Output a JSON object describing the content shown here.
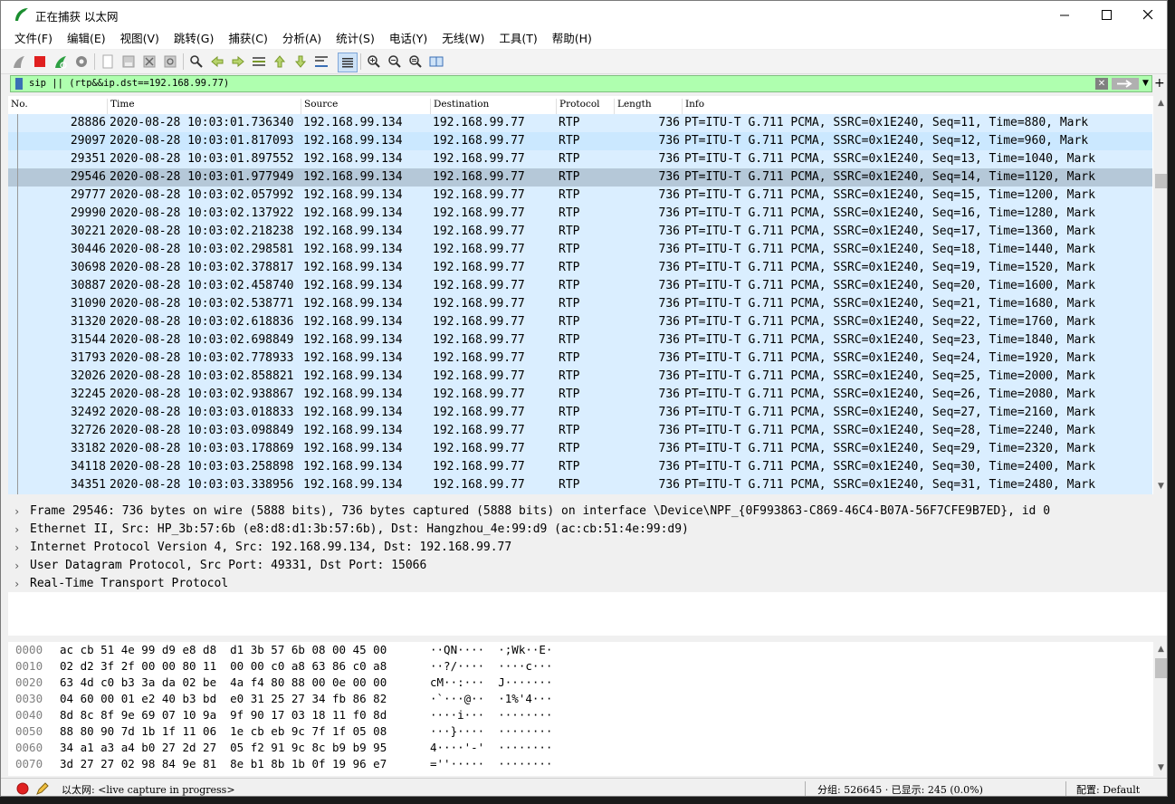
{
  "window": {
    "title": "正在捕获 以太网"
  },
  "menu": [
    "文件(F)",
    "编辑(E)",
    "视图(V)",
    "跳转(G)",
    "捕获(C)",
    "分析(A)",
    "统计(S)",
    "电话(Y)",
    "无线(W)",
    "工具(T)",
    "帮助(H)"
  ],
  "filter": {
    "value": "sip || (rtp&&ip.dst==192.168.99.77)"
  },
  "columns": [
    "No.",
    "Time",
    "Source",
    "Destination",
    "Protocol",
    "Length",
    "Info"
  ],
  "packets": [
    {
      "no": "28886",
      "time": "2020-08-28 10:03:01.736340",
      "src": "192.168.99.134",
      "dst": "192.168.99.77",
      "proto": "RTP",
      "len": "736",
      "info": "PT=ITU-T G.711 PCMA, SSRC=0x1E240, Seq=11, Time=880, Mark"
    },
    {
      "no": "29097",
      "time": "2020-08-28 10:03:01.817093",
      "src": "192.168.99.134",
      "dst": "192.168.99.77",
      "proto": "RTP",
      "len": "736",
      "info": "PT=ITU-T G.711 PCMA, SSRC=0x1E240, Seq=12, Time=960, Mark"
    },
    {
      "no": "29351",
      "time": "2020-08-28 10:03:01.897552",
      "src": "192.168.99.134",
      "dst": "192.168.99.77",
      "proto": "RTP",
      "len": "736",
      "info": "PT=ITU-T G.711 PCMA, SSRC=0x1E240, Seq=13, Time=1040, Mark"
    },
    {
      "no": "29546",
      "time": "2020-08-28 10:03:01.977949",
      "src": "192.168.99.134",
      "dst": "192.168.99.77",
      "proto": "RTP",
      "len": "736",
      "info": "PT=ITU-T G.711 PCMA, SSRC=0x1E240, Seq=14, Time=1120, Mark"
    },
    {
      "no": "29777",
      "time": "2020-08-28 10:03:02.057992",
      "src": "192.168.99.134",
      "dst": "192.168.99.77",
      "proto": "RTP",
      "len": "736",
      "info": "PT=ITU-T G.711 PCMA, SSRC=0x1E240, Seq=15, Time=1200, Mark"
    },
    {
      "no": "29990",
      "time": "2020-08-28 10:03:02.137922",
      "src": "192.168.99.134",
      "dst": "192.168.99.77",
      "proto": "RTP",
      "len": "736",
      "info": "PT=ITU-T G.711 PCMA, SSRC=0x1E240, Seq=16, Time=1280, Mark"
    },
    {
      "no": "30221",
      "time": "2020-08-28 10:03:02.218238",
      "src": "192.168.99.134",
      "dst": "192.168.99.77",
      "proto": "RTP",
      "len": "736",
      "info": "PT=ITU-T G.711 PCMA, SSRC=0x1E240, Seq=17, Time=1360, Mark"
    },
    {
      "no": "30446",
      "time": "2020-08-28 10:03:02.298581",
      "src": "192.168.99.134",
      "dst": "192.168.99.77",
      "proto": "RTP",
      "len": "736",
      "info": "PT=ITU-T G.711 PCMA, SSRC=0x1E240, Seq=18, Time=1440, Mark"
    },
    {
      "no": "30698",
      "time": "2020-08-28 10:03:02.378817",
      "src": "192.168.99.134",
      "dst": "192.168.99.77",
      "proto": "RTP",
      "len": "736",
      "info": "PT=ITU-T G.711 PCMA, SSRC=0x1E240, Seq=19, Time=1520, Mark"
    },
    {
      "no": "30887",
      "time": "2020-08-28 10:03:02.458740",
      "src": "192.168.99.134",
      "dst": "192.168.99.77",
      "proto": "RTP",
      "len": "736",
      "info": "PT=ITU-T G.711 PCMA, SSRC=0x1E240, Seq=20, Time=1600, Mark"
    },
    {
      "no": "31090",
      "time": "2020-08-28 10:03:02.538771",
      "src": "192.168.99.134",
      "dst": "192.168.99.77",
      "proto": "RTP",
      "len": "736",
      "info": "PT=ITU-T G.711 PCMA, SSRC=0x1E240, Seq=21, Time=1680, Mark"
    },
    {
      "no": "31320",
      "time": "2020-08-28 10:03:02.618836",
      "src": "192.168.99.134",
      "dst": "192.168.99.77",
      "proto": "RTP",
      "len": "736",
      "info": "PT=ITU-T G.711 PCMA, SSRC=0x1E240, Seq=22, Time=1760, Mark"
    },
    {
      "no": "31544",
      "time": "2020-08-28 10:03:02.698849",
      "src": "192.168.99.134",
      "dst": "192.168.99.77",
      "proto": "RTP",
      "len": "736",
      "info": "PT=ITU-T G.711 PCMA, SSRC=0x1E240, Seq=23, Time=1840, Mark"
    },
    {
      "no": "31793",
      "time": "2020-08-28 10:03:02.778933",
      "src": "192.168.99.134",
      "dst": "192.168.99.77",
      "proto": "RTP",
      "len": "736",
      "info": "PT=ITU-T G.711 PCMA, SSRC=0x1E240, Seq=24, Time=1920, Mark"
    },
    {
      "no": "32026",
      "time": "2020-08-28 10:03:02.858821",
      "src": "192.168.99.134",
      "dst": "192.168.99.77",
      "proto": "RTP",
      "len": "736",
      "info": "PT=ITU-T G.711 PCMA, SSRC=0x1E240, Seq=25, Time=2000, Mark"
    },
    {
      "no": "32245",
      "time": "2020-08-28 10:03:02.938867",
      "src": "192.168.99.134",
      "dst": "192.168.99.77",
      "proto": "RTP",
      "len": "736",
      "info": "PT=ITU-T G.711 PCMA, SSRC=0x1E240, Seq=26, Time=2080, Mark"
    },
    {
      "no": "32492",
      "time": "2020-08-28 10:03:03.018833",
      "src": "192.168.99.134",
      "dst": "192.168.99.77",
      "proto": "RTP",
      "len": "736",
      "info": "PT=ITU-T G.711 PCMA, SSRC=0x1E240, Seq=27, Time=2160, Mark"
    },
    {
      "no": "32726",
      "time": "2020-08-28 10:03:03.098849",
      "src": "192.168.99.134",
      "dst": "192.168.99.77",
      "proto": "RTP",
      "len": "736",
      "info": "PT=ITU-T G.711 PCMA, SSRC=0x1E240, Seq=28, Time=2240, Mark"
    },
    {
      "no": "33182",
      "time": "2020-08-28 10:03:03.178869",
      "src": "192.168.99.134",
      "dst": "192.168.99.77",
      "proto": "RTP",
      "len": "736",
      "info": "PT=ITU-T G.711 PCMA, SSRC=0x1E240, Seq=29, Time=2320, Mark"
    },
    {
      "no": "34118",
      "time": "2020-08-28 10:03:03.258898",
      "src": "192.168.99.134",
      "dst": "192.168.99.77",
      "proto": "RTP",
      "len": "736",
      "info": "PT=ITU-T G.711 PCMA, SSRC=0x1E240, Seq=30, Time=2400, Mark"
    },
    {
      "no": "34351",
      "time": "2020-08-28 10:03:03.338956",
      "src": "192.168.99.134",
      "dst": "192.168.99.77",
      "proto": "RTP",
      "len": "736",
      "info": "PT=ITU-T G.711 PCMA, SSRC=0x1E240, Seq=31, Time=2480, Mark"
    }
  ],
  "selected_packet": "29546",
  "details": [
    "Frame 29546: 736 bytes on wire (5888 bits), 736 bytes captured (5888 bits) on interface \\Device\\NPF_{0F993863-C869-46C4-B07A-56F7CFE9B7ED}, id 0",
    "Ethernet II, Src: HP_3b:57:6b (e8:d8:d1:3b:57:6b), Dst: Hangzhou_4e:99:d9 (ac:cb:51:4e:99:d9)",
    "Internet Protocol Version 4, Src: 192.168.99.134, Dst: 192.168.99.77",
    "User Datagram Protocol, Src Port: 49331, Dst Port: 15066",
    "Real-Time Transport Protocol"
  ],
  "bytes": [
    {
      "offset": "0000",
      "hex": "ac cb 51 4e 99 d9 e8 d8  d1 3b 57 6b 08 00 45 00",
      "ascii": "··QN····  ·;Wk··E·"
    },
    {
      "offset": "0010",
      "hex": "02 d2 3f 2f 00 00 80 11  00 00 c0 a8 63 86 c0 a8",
      "ascii": "··?/····  ····c···"
    },
    {
      "offset": "0020",
      "hex": "63 4d c0 b3 3a da 02 be  4a f4 80 88 00 0e 00 00",
      "ascii": "cM··:···  J·······"
    },
    {
      "offset": "0030",
      "hex": "04 60 00 01 e2 40 b3 bd  e0 31 25 27 34 fb 86 82",
      "ascii": "·`···@··  ·1%'4···"
    },
    {
      "offset": "0040",
      "hex": "8d 8c 8f 9e 69 07 10 9a  9f 90 17 03 18 11 f0 8d",
      "ascii": "····i···  ········"
    },
    {
      "offset": "0050",
      "hex": "88 80 90 7d 1b 1f 11 06  1e cb eb 9c 7f 1f 05 08",
      "ascii": "···}····  ········"
    },
    {
      "offset": "0060",
      "hex": "34 a1 a3 a4 b0 27 2d 27  05 f2 91 9c 8c b9 b9 95",
      "ascii": "4····'-'  ········"
    },
    {
      "offset": "0070",
      "hex": "3d 27 27 02 98 84 9e 81  8e b1 8b 1b 0f 19 96 e7",
      "ascii": "=''·····  ········"
    }
  ],
  "status": {
    "interface": "以太网: <live capture in progress>",
    "packets": "分组: 526645 · 已显示: 245 (0.0%)",
    "profile": "配置: Default"
  }
}
